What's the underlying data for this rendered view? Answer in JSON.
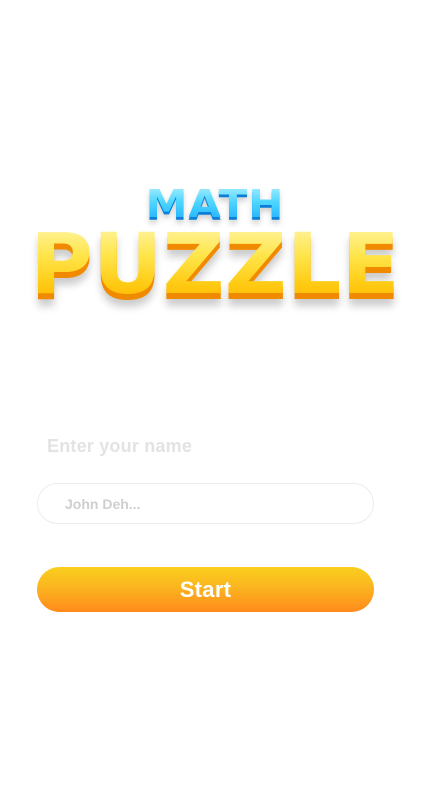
{
  "logo": {
    "line1": "MATH",
    "line2": "PUZZLE"
  },
  "name_form": {
    "label": "Enter your name",
    "placeholder": "John Deh...",
    "value": ""
  },
  "start_button": {
    "label": "Start"
  },
  "colors": {
    "background": "#ffffff",
    "math_text": "#35c7ff",
    "puzzle_text": "#ffd21a",
    "button_gradient_top": "#f9cf1e",
    "button_gradient_bottom": "#ff8a1c",
    "label_text": "#e3e3e3",
    "input_border": "#ececec"
  }
}
